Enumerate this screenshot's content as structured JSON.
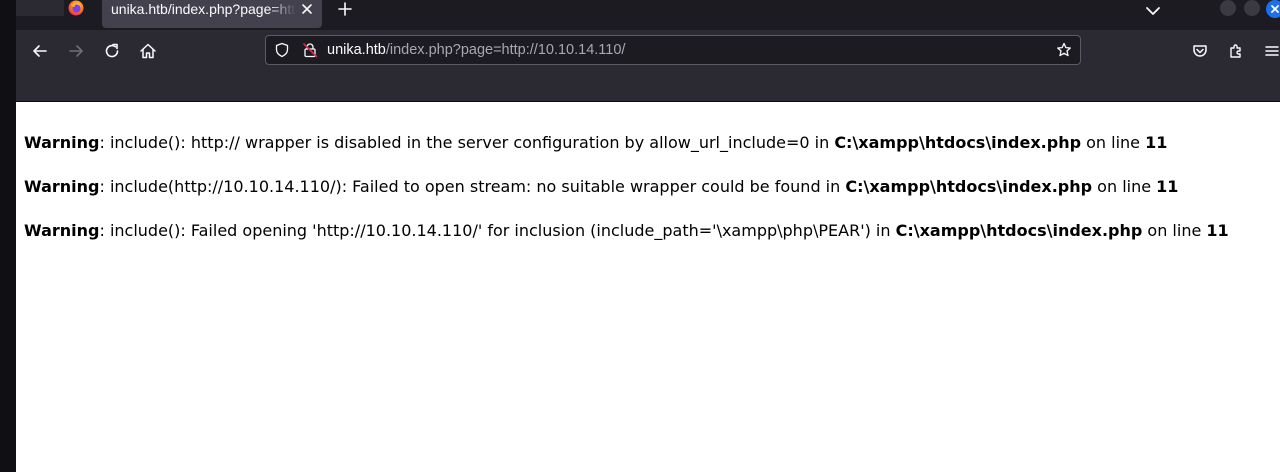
{
  "tab": {
    "title": "unika.htb/index.php?page=http://10.10.14.110/"
  },
  "url": {
    "host": "unika.htb",
    "path": "/index.php?page=http://10.10.14.110/"
  },
  "icons": {
    "browser": "firefox-icon",
    "tab_close": "close-icon",
    "new_tab": "plus-icon",
    "tab_list": "chevron-down-icon",
    "back": "arrow-left-icon",
    "forward": "arrow-right-icon",
    "reload": "reload-icon",
    "home": "home-icon",
    "tracking": "shield-icon",
    "insecure": "lock-slash-icon",
    "bookmark": "star-icon",
    "pocket": "pocket-icon",
    "extensions": "puzzle-icon",
    "menu": "hamburger-icon"
  },
  "colors": {
    "toolbar": "#2b2a33",
    "tabstrip": "#1c1b22",
    "window_close": "#1f6feb"
  },
  "warnings": [
    {
      "label": "Warning",
      "message": ": include(): http:// wrapper is disabled in the server configuration by allow_url_include=0 in ",
      "file": "C:\\xampp\\htdocs\\index.php",
      "line_text": " on line ",
      "line": "11"
    },
    {
      "label": "Warning",
      "message": ": include(http://10.10.14.110/): Failed to open stream: no suitable wrapper could be found in ",
      "file": "C:\\xampp\\htdocs\\index.php",
      "line_text": " on line ",
      "line": "11"
    },
    {
      "label": "Warning",
      "message": ": include(): Failed opening 'http://10.10.14.110/' for inclusion (include_path='\\xampp\\php\\PEAR') in ",
      "file": "C:\\xampp\\htdocs\\index.php",
      "line_text": " on line ",
      "line": "11"
    }
  ]
}
